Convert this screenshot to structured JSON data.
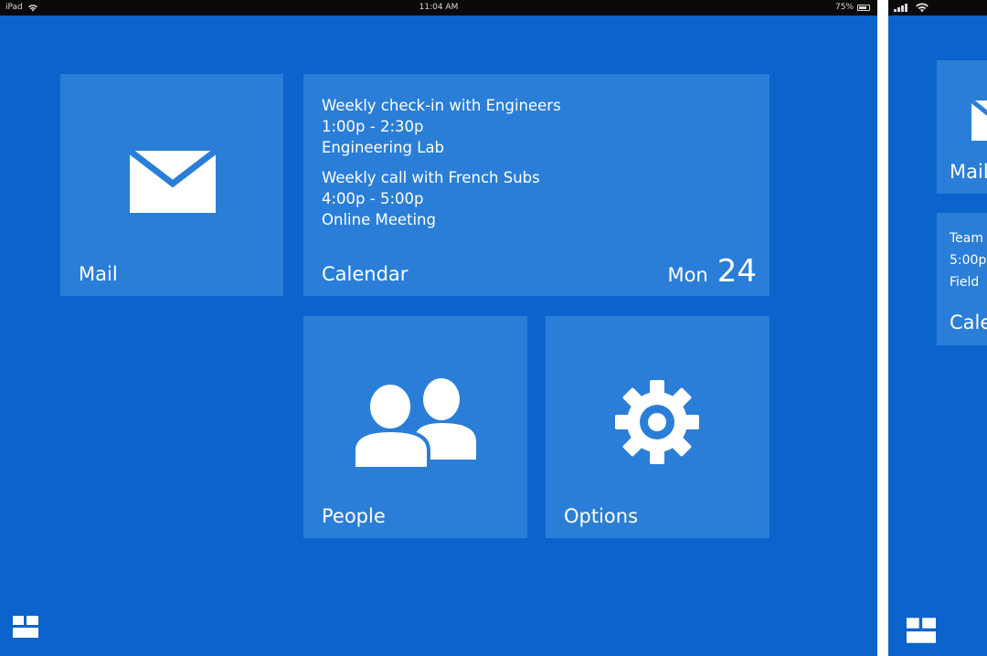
{
  "status_bar": {
    "device": "iPad",
    "time": "11:04 AM",
    "battery": "75%"
  },
  "tiles": {
    "mail": {
      "label": "Mail",
      "icon": "mail-icon"
    },
    "calendar": {
      "label": "Calendar",
      "day": "Mon",
      "date": "24",
      "events": [
        {
          "title": "Weekly check-in with Engineers",
          "time": "1:00p - 2:30p",
          "location": "Engineering Lab"
        },
        {
          "title": "Weekly call with French Subs",
          "time": "4:00p - 5:00p",
          "location": "Online Meeting"
        }
      ]
    },
    "people": {
      "label": "People",
      "icon": "people-icon"
    },
    "options": {
      "label": "Options",
      "icon": "gear-icon"
    }
  },
  "start_button": {
    "icon": "start-tiles-icon"
  },
  "side_screen": {
    "mail_label": "Mail",
    "calendar_lines": [
      "Team",
      "5:00p",
      "Field"
    ],
    "calendar_label": "Cale"
  },
  "colors": {
    "background": "#0c63cc",
    "tile": "#2a7ed8",
    "text": "#ffffff",
    "status_bar": "#0a0a0a"
  }
}
